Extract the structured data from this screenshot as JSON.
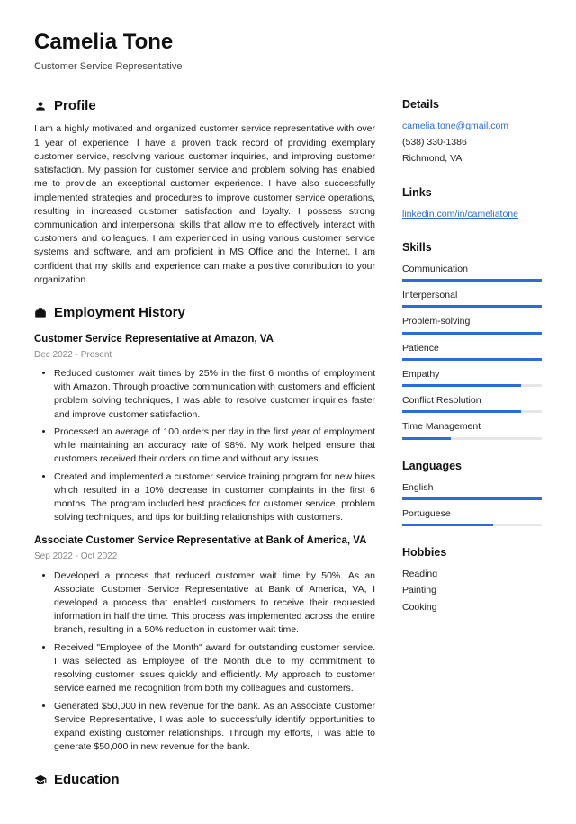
{
  "header": {
    "name": "Camelia Tone",
    "title": "Customer Service Representative"
  },
  "profile": {
    "heading": "Profile",
    "text": "I am a highly motivated and organized customer service representative with over 1 year of experience. I have a proven track record of providing exemplary customer service, resolving various customer inquiries, and improving customer satisfaction. My passion for customer service and problem solving has enabled me to provide an exceptional customer experience. I have also successfully implemented strategies and procedures to improve customer service operations, resulting in increased customer satisfaction and loyalty. I possess strong communication and interpersonal skills that allow me to effectively interact with customers and colleagues. I am experienced in using various customer service systems and software, and am proficient in MS Office and the Internet. I am confident that my skills and experience can make a positive contribution to your organization."
  },
  "employment": {
    "heading": "Employment History",
    "jobs": [
      {
        "title": "Customer Service Representative at Amazon, VA",
        "dates": "Dec 2022 - Present",
        "bullets": [
          "Reduced customer wait times by 25% in the first 6 months of employment with Amazon. Through proactive communication with customers and efficient problem solving techniques, I was able to resolve customer inquiries faster and improve customer satisfaction.",
          "Processed an average of 100 orders per day in the first year of employment while maintaining an accuracy rate of 98%. My work helped ensure that customers received their orders on time and without any issues.",
          "Created and implemented a customer service training program for new hires which resulted in a 10% decrease in customer complaints in the first 6 months. The program included best practices for customer service, problem solving techniques, and tips for building relationships with customers."
        ]
      },
      {
        "title": "Associate Customer Service Representative at Bank of America, VA",
        "dates": "Sep 2022 - Oct 2022",
        "bullets": [
          "Developed a process that reduced customer wait time by 50%. As an Associate Customer Service Representative at Bank of America, VA, I developed a process that enabled customers to receive their requested information in half the time. This process was implemented across the entire branch, resulting in a 50% reduction in customer wait time.",
          "Received \"Employee of the Month\" award for outstanding customer service. I was selected as Employee of the Month due to my commitment to resolving customer issues quickly and efficiently. My approach to customer service earned me recognition from both my colleagues and customers.",
          "Generated $50,000 in new revenue for the bank. As an Associate Customer Service Representative, I was able to successfully identify opportunities to expand existing customer relationships. Through my efforts, I was able to generate $50,000 in new revenue for the bank."
        ]
      }
    ]
  },
  "education": {
    "heading": "Education"
  },
  "details": {
    "heading": "Details",
    "email": "camelia.tone@gmail.com",
    "phone": "(538) 330-1386",
    "location": "Richmond, VA"
  },
  "links": {
    "heading": "Links",
    "items": [
      "linkedin.com/in/cameliatone"
    ]
  },
  "skills": {
    "heading": "Skills",
    "items": [
      {
        "name": "Communication",
        "level": 100
      },
      {
        "name": "Interpersonal",
        "level": 100
      },
      {
        "name": "Problem-solving",
        "level": 100
      },
      {
        "name": "Patience",
        "level": 100
      },
      {
        "name": "Empathy",
        "level": 85
      },
      {
        "name": "Conflict Resolution",
        "level": 85
      },
      {
        "name": "Time Management",
        "level": 35
      }
    ]
  },
  "languages": {
    "heading": "Languages",
    "items": [
      {
        "name": "English",
        "level": 100
      },
      {
        "name": "Portuguese",
        "level": 65
      }
    ]
  },
  "hobbies": {
    "heading": "Hobbies",
    "items": [
      "Reading",
      "Painting",
      "Cooking"
    ]
  }
}
